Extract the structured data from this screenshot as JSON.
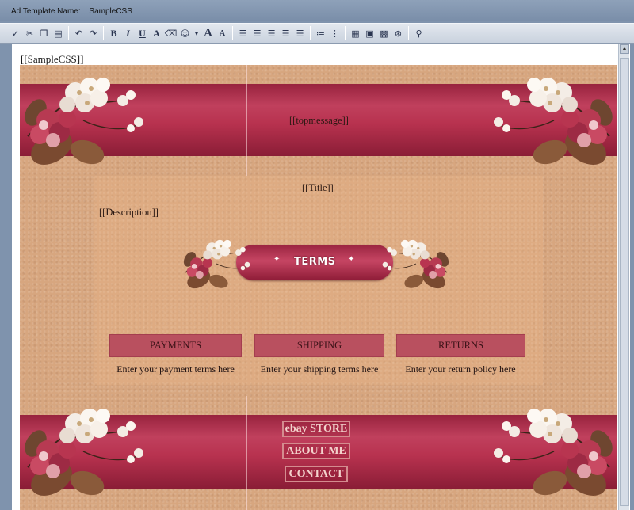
{
  "window": {
    "label": "Ad Template Name:",
    "template_name": "SampleCSS"
  },
  "toolbar": {
    "buttons": [
      "spell-check",
      "cut",
      "copy",
      "paste",
      "undo",
      "redo",
      "bold",
      "italic",
      "underline",
      "font-color",
      "highlight",
      "insert-symbol",
      "grow-font",
      "shrink-font",
      "align-left",
      "align-center",
      "align-right",
      "justify",
      "justify-full",
      "bulleted-list",
      "numbered-list",
      "insert-table",
      "insert-box",
      "insert-image",
      "insert-link",
      "find"
    ],
    "glyphs": {
      "bold": "B",
      "italic": "I",
      "underline": "U",
      "font_color": "A",
      "grow_font": "A",
      "shrink_font": "A"
    }
  },
  "editor": {
    "template_tag": "[[SampleCSS]]",
    "topmessage": "[[topmessage]]",
    "title": "[[Title]]",
    "description": "[[Description]]",
    "banner": "TERMS",
    "sections": [
      {
        "heading": "PAYMENTS",
        "text": "Enter your payment terms here"
      },
      {
        "heading": "SHIPPING",
        "text": "Enter your shipping terms here"
      },
      {
        "heading": "RETURNS",
        "text": "Enter your return policy here"
      }
    ],
    "nav": [
      "ebay STORE",
      "ABOUT ME",
      "CONTACT"
    ]
  },
  "colors": {
    "band": "#b8324f",
    "parchment": "#d7a67f",
    "heading_box": "#b9505f",
    "nav_border": "#d48c8f"
  }
}
